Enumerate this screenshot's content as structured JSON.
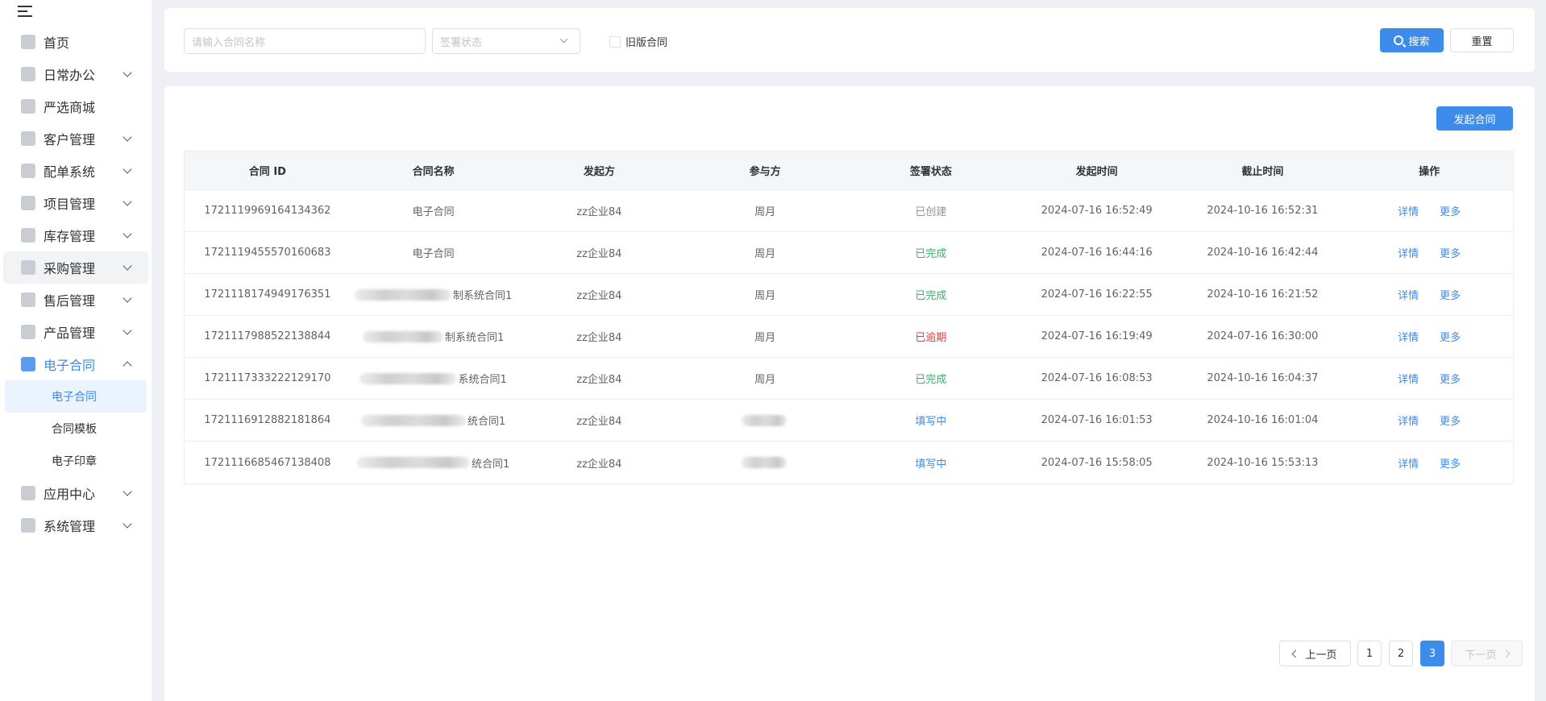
{
  "sidebar": {
    "items": [
      {
        "label": "首页",
        "icon": "home-icon",
        "has_children": false
      },
      {
        "label": "日常办公",
        "icon": "briefcase-icon",
        "has_children": true
      },
      {
        "label": "严选商城",
        "icon": "store-icon",
        "has_children": false
      },
      {
        "label": "客户管理",
        "icon": "customer-icon",
        "has_children": true
      },
      {
        "label": "配单系统",
        "icon": "order-icon",
        "has_children": true
      },
      {
        "label": "项目管理",
        "icon": "folder-icon",
        "has_children": true
      },
      {
        "label": "库存管理",
        "icon": "inventory-icon",
        "has_children": true
      },
      {
        "label": "采购管理",
        "icon": "cart-icon",
        "has_children": true
      },
      {
        "label": "售后管理",
        "icon": "headset-icon",
        "has_children": true
      },
      {
        "label": "产品管理",
        "icon": "product-icon",
        "has_children": true
      },
      {
        "label": "电子合同",
        "icon": "contract-icon",
        "has_children": true,
        "expanded": true
      },
      {
        "label": "应用中心",
        "icon": "apps-icon",
        "has_children": true
      },
      {
        "label": "系统管理",
        "icon": "settings-icon",
        "has_children": true
      }
    ],
    "submenu": [
      {
        "label": "电子合同",
        "active": true
      },
      {
        "label": "合同模板",
        "active": false
      },
      {
        "label": "电子印章",
        "active": false
      }
    ]
  },
  "search": {
    "name_placeholder": "请输入合同名称",
    "status_placeholder": "签署状态",
    "old_version_label": "旧版合同",
    "search_label": "搜索",
    "reset_label": "重置"
  },
  "actions": {
    "launch_label": "发起合同"
  },
  "table": {
    "headers": [
      "合同 ID",
      "合同名称",
      "发起方",
      "参与方",
      "签署状态",
      "发起时间",
      "截止时间",
      "操作"
    ],
    "rows": [
      {
        "id": "1721119969164134362",
        "name": "电子合同",
        "name_blurred": false,
        "initiator": "zz企业84",
        "participant": "周月",
        "status": "已创建",
        "status_type": "created",
        "start": "2024-07-16 16:52:49",
        "end": "2024-10-16 16:52:31"
      },
      {
        "id": "1721119455570160683",
        "name": "电子合同",
        "name_blurred": false,
        "initiator": "zz企业84",
        "participant": "周月",
        "status": "已完成",
        "status_type": "done",
        "start": "2024-07-16 16:44:16",
        "end": "2024-10-16 16:42:44"
      },
      {
        "id": "1721118174949176351",
        "name": "制系统合同1",
        "name_blurred": true,
        "initiator": "zz企业84",
        "participant": "周月",
        "status": "已完成",
        "status_type": "done",
        "start": "2024-07-16 16:22:55",
        "end": "2024-10-16 16:21:52"
      },
      {
        "id": "1721117988522138844",
        "name": "制系统合同1",
        "name_blurred": true,
        "initiator": "zz企业84",
        "participant": "周月",
        "status": "已逾期",
        "status_type": "overdue",
        "start": "2024-07-16 16:19:49",
        "end": "2024-07-16 16:30:00"
      },
      {
        "id": "1721117333222129170",
        "name": "系统合同1",
        "name_blurred": true,
        "initiator": "zz企业84",
        "participant": "周月",
        "status": "已完成",
        "status_type": "done",
        "start": "2024-07-16 16:08:53",
        "end": "2024-10-16 16:04:37"
      },
      {
        "id": "1721116912882181864",
        "name": "统合同1",
        "name_blurred": true,
        "initiator": "zz企业84",
        "participant": "",
        "status": "填写中",
        "status_type": "filling",
        "start": "2024-07-16 16:01:53",
        "end": "2024-10-16 16:01:04"
      },
      {
        "id": "1721116685467138408",
        "name": "统合同1",
        "name_blurred": true,
        "initiator": "zz企业84",
        "participant": "",
        "status": "填写中",
        "status_type": "filling",
        "start": "2024-07-16 15:58:05",
        "end": "2024-10-16 15:53:13"
      }
    ],
    "detail_label": "详情",
    "more_label": "更多"
  },
  "pagination": {
    "prev_label": "上一页",
    "next_label": "下一页",
    "pages": [
      "1",
      "2",
      "3"
    ],
    "current": "3"
  },
  "colors": {
    "accent": "#3d8bea",
    "done": "#3fae6f",
    "overdue": "#e4393c",
    "created": "#909399"
  }
}
